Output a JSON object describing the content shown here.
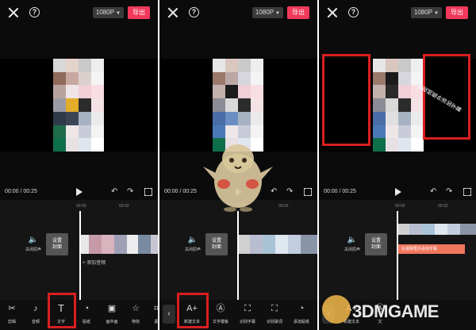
{
  "common": {
    "resolution": "1080P",
    "export": "导出",
    "time": "00:00 / 00:25",
    "ruler": [
      "00:00",
      "00:02"
    ],
    "mute_label": "关闭原声",
    "cover_label": "设置\n封面"
  },
  "panel1": {
    "add_audio": "+ 添加音频",
    "tools": [
      {
        "icon": "scissors-icon",
        "label": "剪辑"
      },
      {
        "icon": "note-icon",
        "label": "音频"
      },
      {
        "icon": "text-icon",
        "label": "文字"
      },
      {
        "icon": "sticker-icon",
        "label": "贴纸"
      },
      {
        "icon": "pip-icon",
        "label": "画中画"
      },
      {
        "icon": "effect-icon",
        "label": "特效"
      },
      {
        "icon": "more-icon",
        "label": "素"
      }
    ]
  },
  "panel2": {
    "tools": [
      {
        "icon": "new-text-icon",
        "label": "新建文本"
      },
      {
        "icon": "template-icon",
        "label": "文字模板"
      },
      {
        "icon": "caption-icon",
        "label": "识别字幕"
      },
      {
        "icon": "lyrics-icon",
        "label": "识别歌词"
      },
      {
        "icon": "sticker-icon",
        "label": "添加贴纸"
      }
    ]
  },
  "panel3": {
    "text_track": "在视频框外添加字幕",
    "overlay_text": "在视频框外添加字幕",
    "tools": [
      {
        "icon": "new-text-icon",
        "label": "新建文本"
      },
      {
        "icon": "template-icon",
        "label": "文"
      },
      {
        "icon": "caption-icon",
        "label": ""
      }
    ]
  },
  "watermark": "3DMGAME",
  "colors": {
    "accent": "#f2395b",
    "highlight": "#d91f1f",
    "text_track": "#f0775e"
  }
}
